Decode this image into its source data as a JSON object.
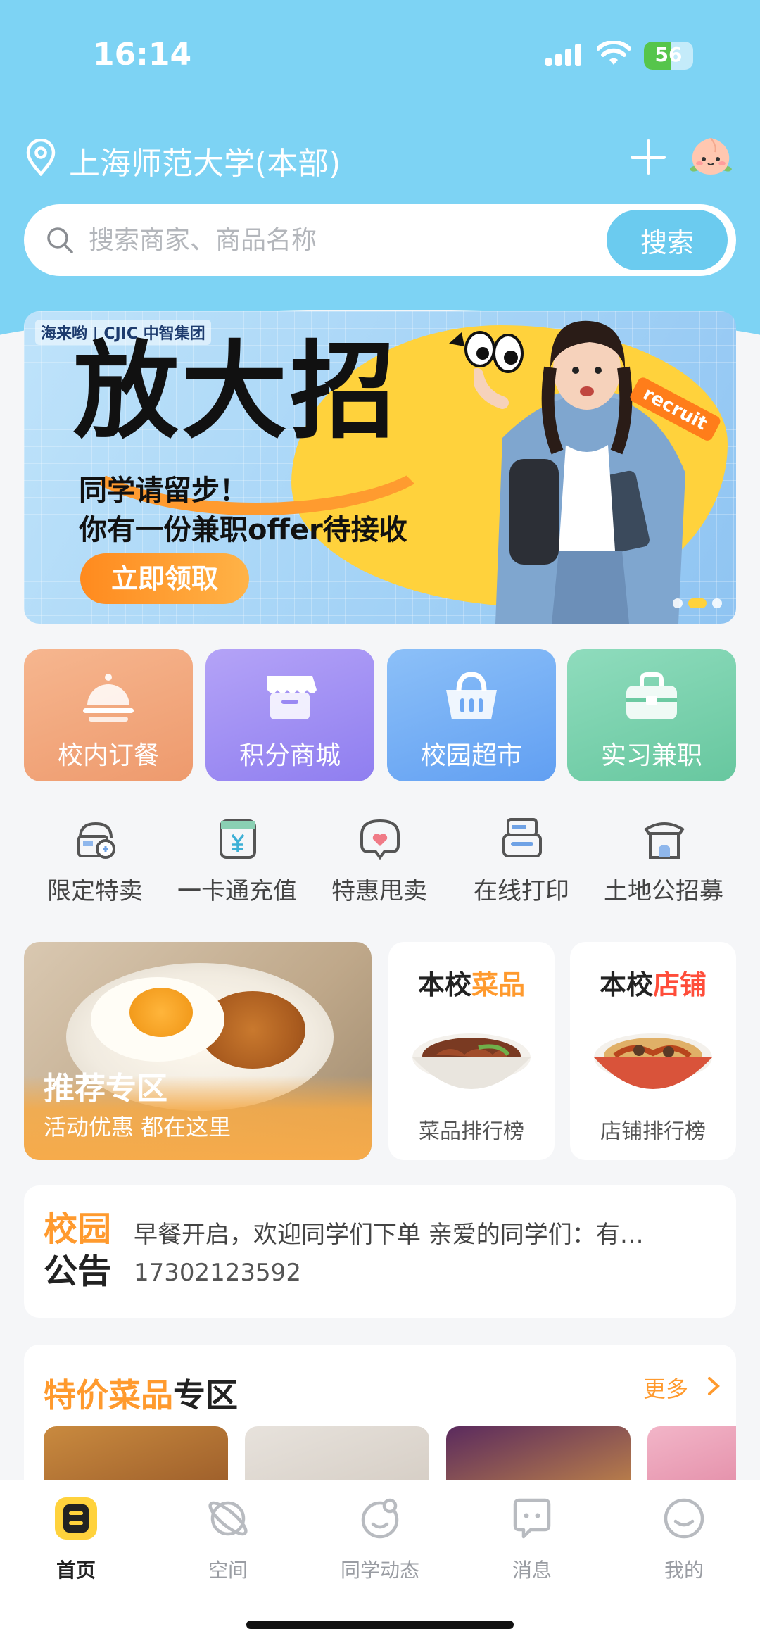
{
  "status": {
    "time": "16:14",
    "battery": "56"
  },
  "header": {
    "campus": "上海师范大学(本部)"
  },
  "search": {
    "placeholder": "搜索商家、商品名称",
    "button": "搜索"
  },
  "banner": {
    "brand": "海来哟 | CJIC 中智集团",
    "title": "放大招",
    "line1": "同学请留步！",
    "line2": "你有一份兼职offer待接收",
    "cta": "立即领取",
    "tag": "recruit"
  },
  "quick_tiles": [
    {
      "label": "校内订餐",
      "icon": "food-cloche-icon",
      "color": "#f0a57a"
    },
    {
      "label": "积分商城",
      "icon": "shop-icon",
      "color": "#a492f4"
    },
    {
      "label": "校园超市",
      "icon": "basket-icon",
      "color": "#76b1f6"
    },
    {
      "label": "实习兼职",
      "icon": "briefcase-icon",
      "color": "#7ad3ad"
    }
  ],
  "services": [
    {
      "label": "限定特卖",
      "icon": "limited-sale-icon"
    },
    {
      "label": "一卡通充值",
      "icon": "card-recharge-icon"
    },
    {
      "label": "特惠甩卖",
      "icon": "discount-heart-icon"
    },
    {
      "label": "在线打印",
      "icon": "printer-icon"
    },
    {
      "label": "土地公招募",
      "icon": "shrine-icon"
    }
  ],
  "recommend": {
    "title": "推荐专区",
    "subtitle": "活动优惠 都在这里"
  },
  "rankings": [
    {
      "title_a": "本校",
      "title_b": "菜品",
      "label": "菜品排行榜"
    },
    {
      "title_a": "本校",
      "title_b": "店铺",
      "label": "店铺排行榜"
    }
  ],
  "notice": {
    "logo_a": "校园",
    "logo_b": "公告",
    "text": "早餐开启，欢迎同学们下单 亲爱的同学们：有…",
    "phone": "17302123592"
  },
  "special": {
    "title_a": "特价菜品",
    "title_b": "专区",
    "more": "更多"
  },
  "tabs": [
    {
      "label": "首页",
      "icon": "home-icon"
    },
    {
      "label": "空间",
      "icon": "planet-icon"
    },
    {
      "label": "同学动态",
      "icon": "moments-icon"
    },
    {
      "label": "消息",
      "icon": "message-icon"
    },
    {
      "label": "我的",
      "icon": "profile-icon"
    }
  ],
  "colors": {
    "accent": "#ff9a2e",
    "header": "#7dd3f4",
    "search_btn": "#6bcbef"
  }
}
